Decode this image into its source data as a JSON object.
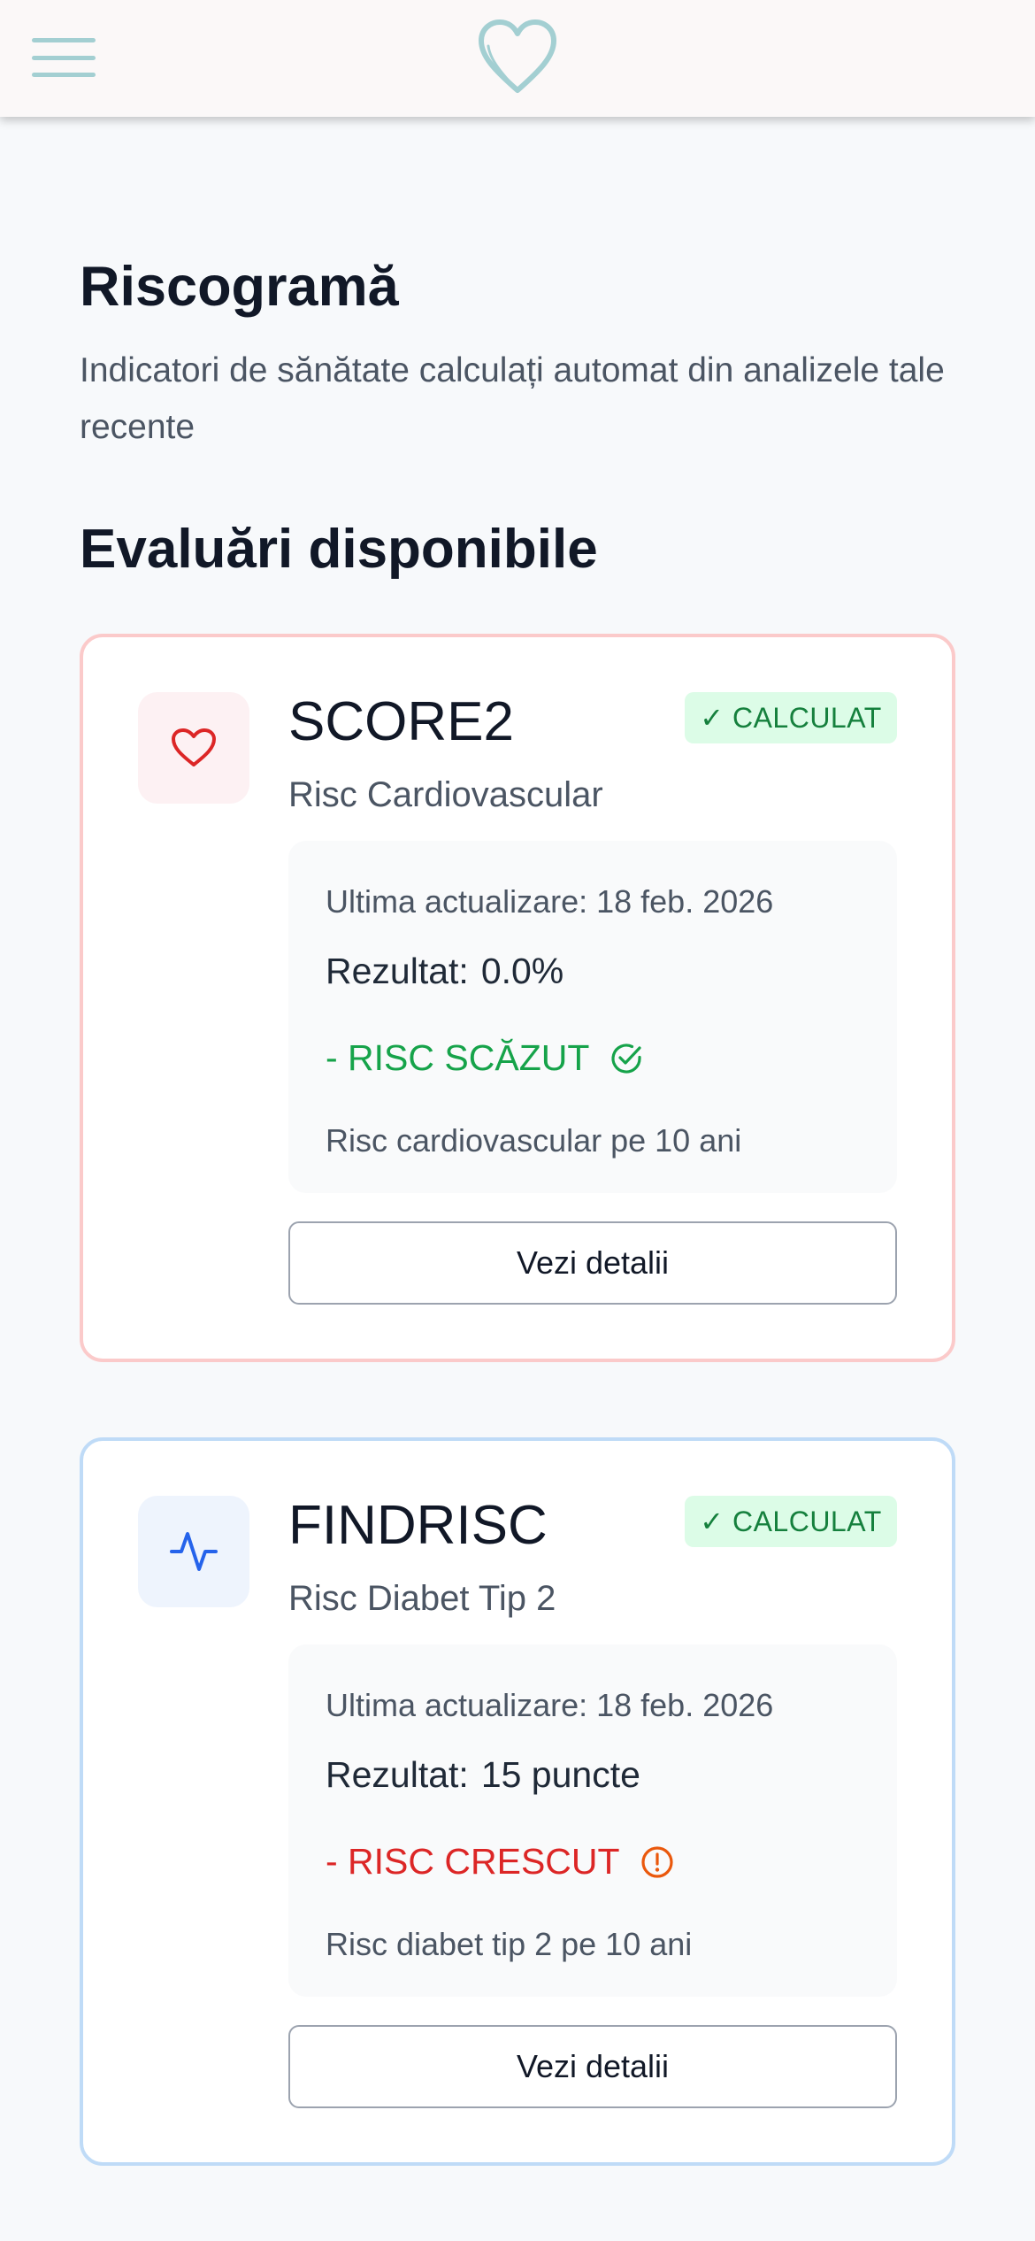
{
  "header": {
    "menu_icon": "hamburger-menu-icon",
    "logo_icon": "heart-outline-logo-icon",
    "accent_color": "#a3cfd2"
  },
  "page": {
    "title": "Riscogramă",
    "subtitle": "Indicatori de sănătate calculați automat din analizele tale recente",
    "section_title": "Evaluări disponibile"
  },
  "assessments": [
    {
      "name": "SCORE2",
      "description": "Risc Cardiovascular",
      "status": "✓ CALCULAT",
      "updated": "Ultima actualizare: 18 feb. 2026",
      "result_label": "Rezultat:",
      "result_value": "0.0%",
      "risk_label": "- RISC SCĂZUT",
      "risk_description": "Risc cardiovascular pe 10 ani",
      "button_label": "Vezi detalii",
      "icon": "heart-icon",
      "risk_icon": "check-circle-icon",
      "accent_color": "#dc2626"
    },
    {
      "name": "FINDRISC",
      "description": "Risc Diabet Tip 2",
      "status": "✓ CALCULAT",
      "updated": "Ultima actualizare: 18 feb. 2026",
      "result_label": "Rezultat:",
      "result_value": "15 puncte",
      "risk_label": "- RISC CRESCUT",
      "risk_description": "Risc diabet tip 2 pe 10 ani",
      "button_label": "Vezi detalii",
      "icon": "activity-pulse-icon",
      "risk_icon": "alert-circle-icon",
      "accent_color": "#2563eb"
    }
  ]
}
